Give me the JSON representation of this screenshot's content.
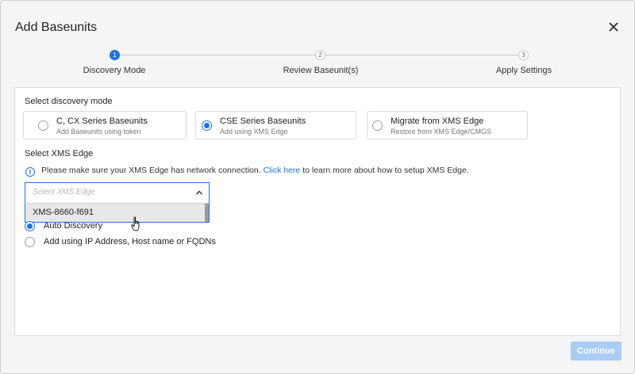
{
  "dialog": {
    "title": "Add Baseunits",
    "close_icon": "close-icon"
  },
  "stepper": {
    "steps": [
      {
        "number": "1",
        "label": "Discovery Mode",
        "state": "active"
      },
      {
        "number": "2",
        "label": "Review Baseunit(s)",
        "state": "pending"
      },
      {
        "number": "3",
        "label": "Apply Settings",
        "state": "pending"
      }
    ],
    "active_color": "#1a73e8"
  },
  "discovery": {
    "section_label": "Select discovery mode",
    "modes": [
      {
        "title": "C, CX Series Baseunits",
        "subtitle": "Add Baseunits using token",
        "selected": false
      },
      {
        "title": "CSE Series Baseunits",
        "subtitle": "Add using XMS Edge",
        "selected": true
      },
      {
        "title": "Migrate from XMS Edge",
        "subtitle": "Restore from XMS Edge/CMGS",
        "selected": false
      }
    ]
  },
  "xms_edge": {
    "section_label": "Select XMS Edge",
    "info_icon": "info-icon",
    "info_text_before": "Please make sure your XMS Edge has network connection.",
    "info_link": "Click here",
    "info_text_after": "to learn more about how to setup XMS Edge.",
    "select_placeholder": "Select XMS Edge",
    "dropdown_options": [
      "XMS-8660-f691"
    ]
  },
  "method": {
    "options": [
      {
        "label": "Auto Discovery",
        "selected": true
      },
      {
        "label": "Add using IP Address, Host name or FQDNs",
        "selected": false
      }
    ]
  },
  "footer": {
    "continue_label": "Continue",
    "continue_color": "#a9cdf5"
  }
}
